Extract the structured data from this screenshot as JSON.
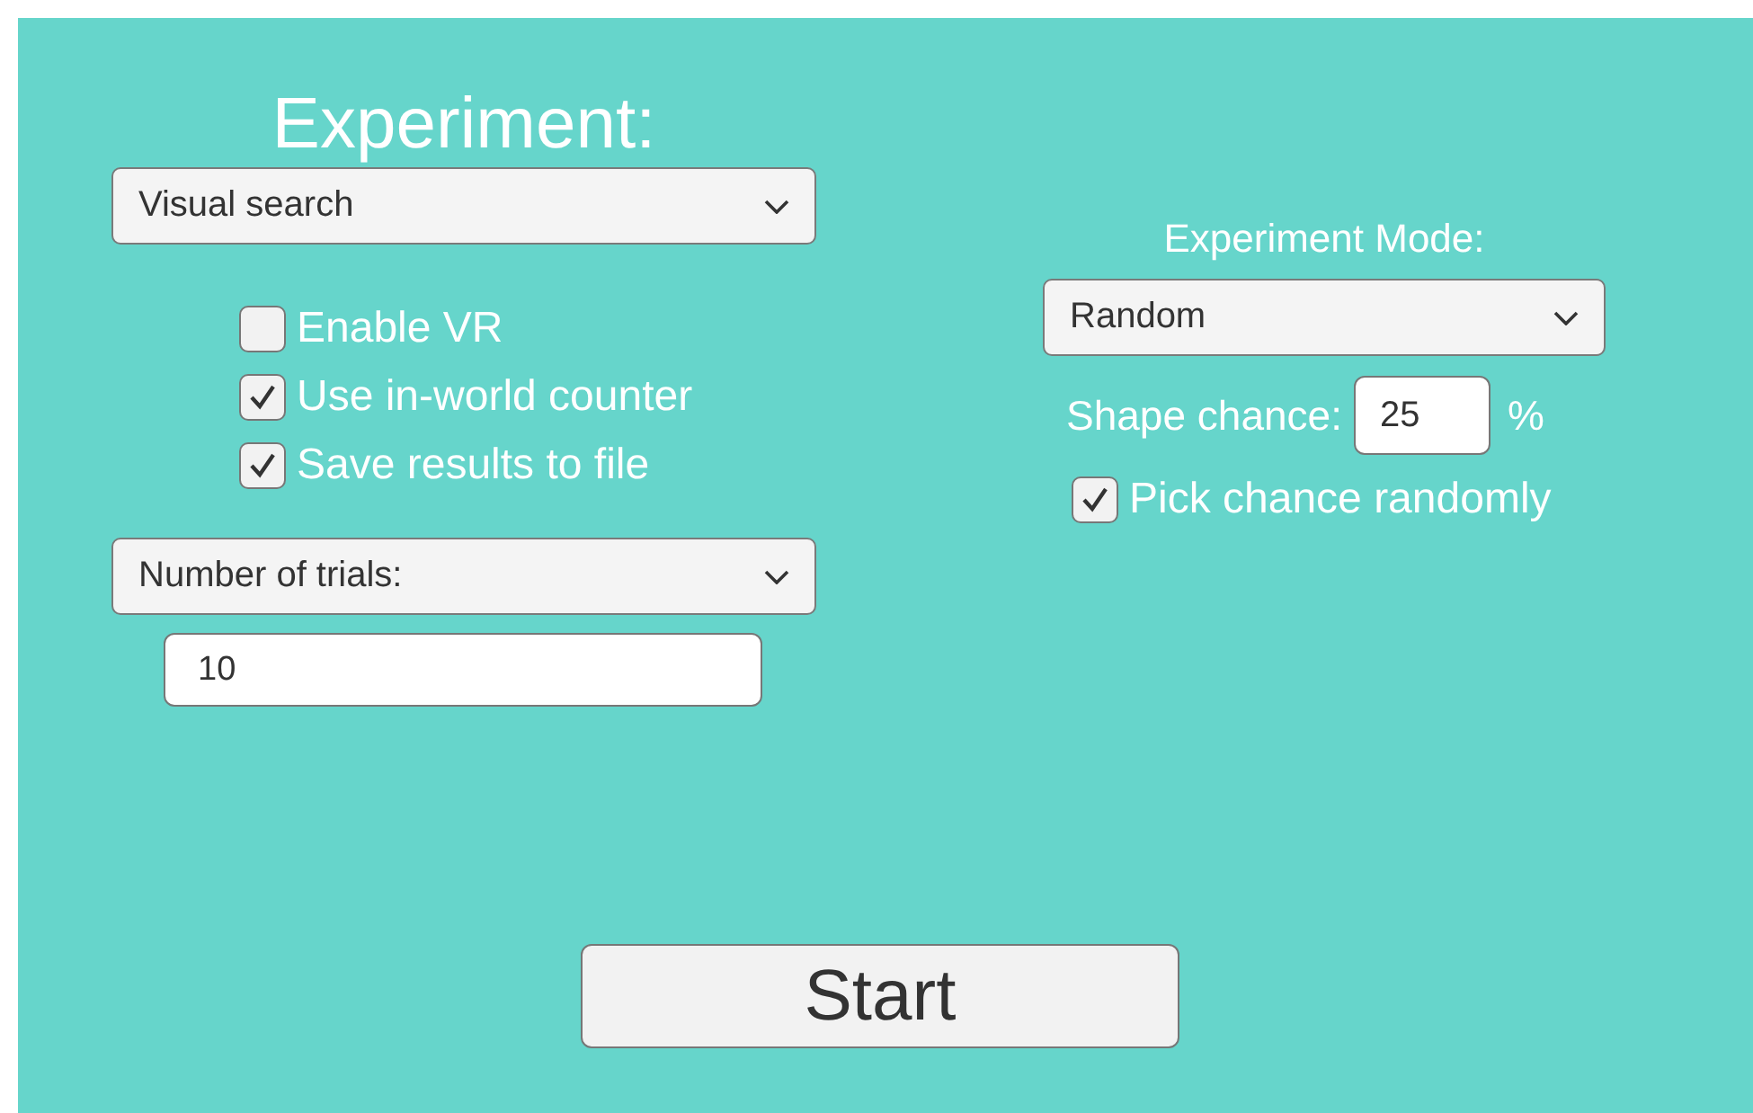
{
  "title": "Experiment:",
  "experiment_select": {
    "value": "Visual search"
  },
  "options": [
    {
      "label": "Enable VR",
      "checked": false
    },
    {
      "label": "Use in-world counter",
      "checked": true
    },
    {
      "label": "Save results to file",
      "checked": true
    }
  ],
  "trials_select": {
    "value": "Number of trials:"
  },
  "trials_input": {
    "value": "10"
  },
  "mode": {
    "label": "Experiment Mode:",
    "select": {
      "value": "Random"
    },
    "shape_chance": {
      "label": "Shape chance:",
      "value": "25",
      "unit": "%"
    },
    "pick_randomly": {
      "label": "Pick chance randomly",
      "checked": true
    }
  },
  "start_button": {
    "label": "Start"
  }
}
